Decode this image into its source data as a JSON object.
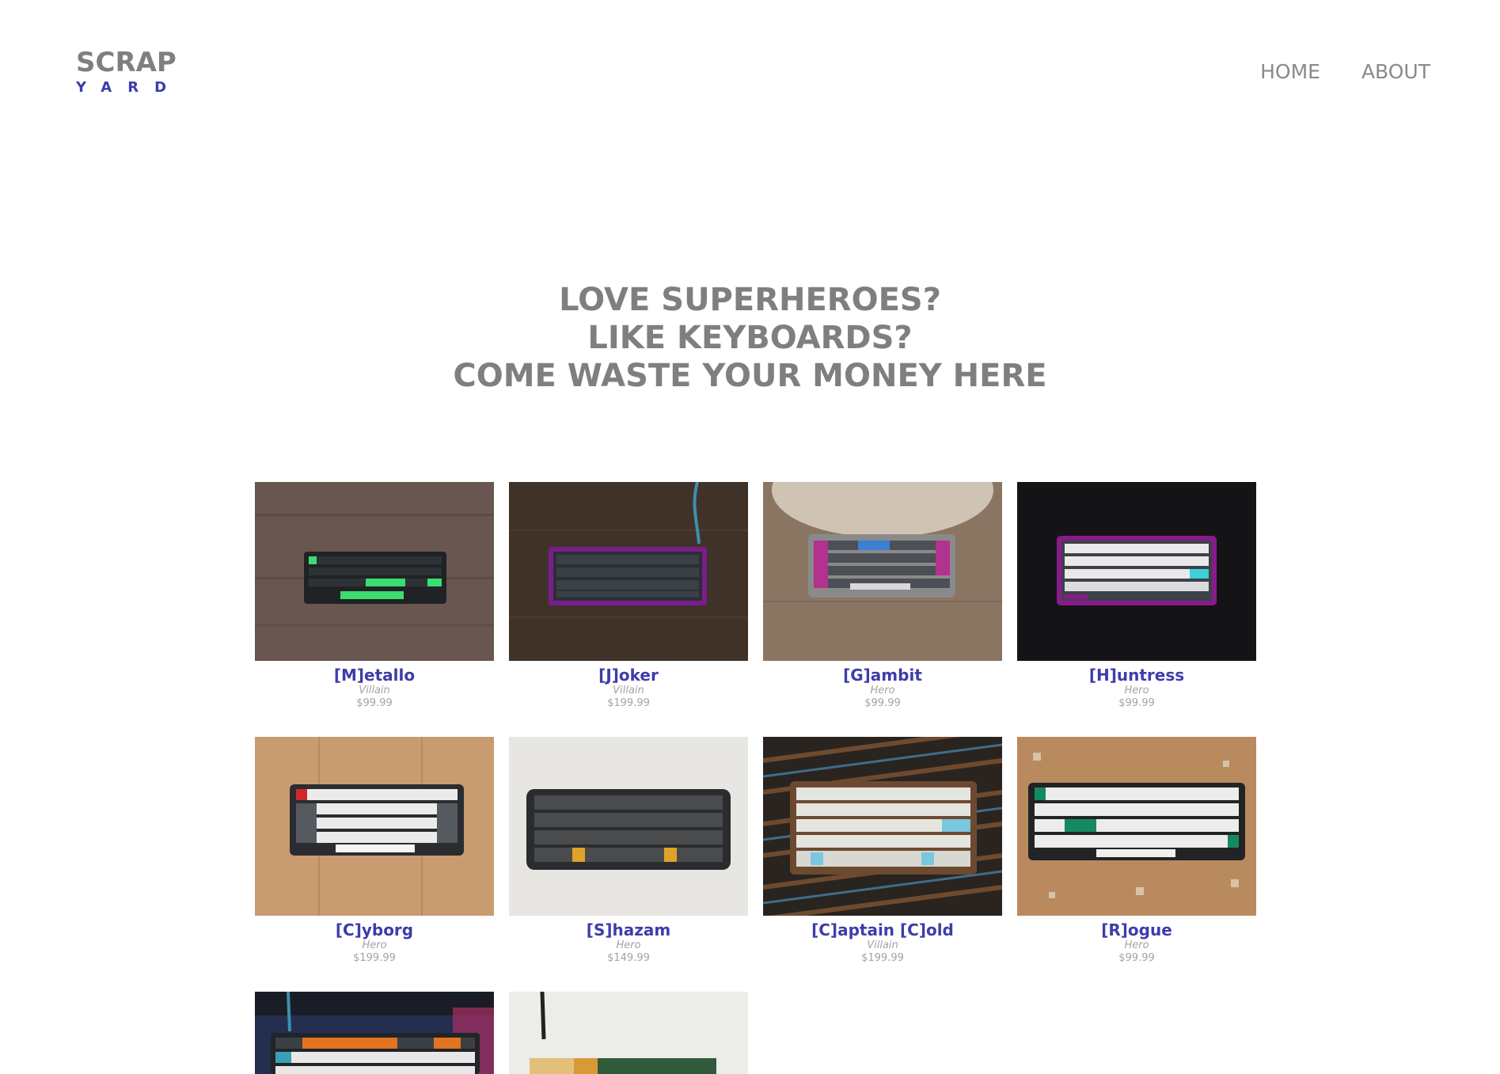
{
  "logo": {
    "top": "SCRAP",
    "bottom": "YARD"
  },
  "nav": {
    "home": "HOME",
    "about": "ABOUT"
  },
  "hero": {
    "line1": "LOVE SUPERHEROES?",
    "line2": "LIKE KEYBOARDS?",
    "line3": "COME WASTE YOUR MONEY HERE"
  },
  "products": [
    {
      "name": "[M]etallo",
      "role": "Villain",
      "price": "$99.99"
    },
    {
      "name": "[J]oker",
      "role": "Villain",
      "price": "$199.99"
    },
    {
      "name": "[G]ambit",
      "role": "Hero",
      "price": "$99.99"
    },
    {
      "name": "[H]untress",
      "role": "Hero",
      "price": "$99.99"
    },
    {
      "name": "[C]yborg",
      "role": "Hero",
      "price": "$199.99"
    },
    {
      "name": "[S]hazam",
      "role": "Hero",
      "price": "$149.99"
    },
    {
      "name": "[C]aptain [C]old",
      "role": "Villain",
      "price": "$199.99"
    },
    {
      "name": "[R]ogue",
      "role": "Hero",
      "price": "$99.99"
    }
  ],
  "colors": {
    "brand": "#3d3dab",
    "text": "#7f7f7f",
    "muted": "#a3a3a3"
  }
}
